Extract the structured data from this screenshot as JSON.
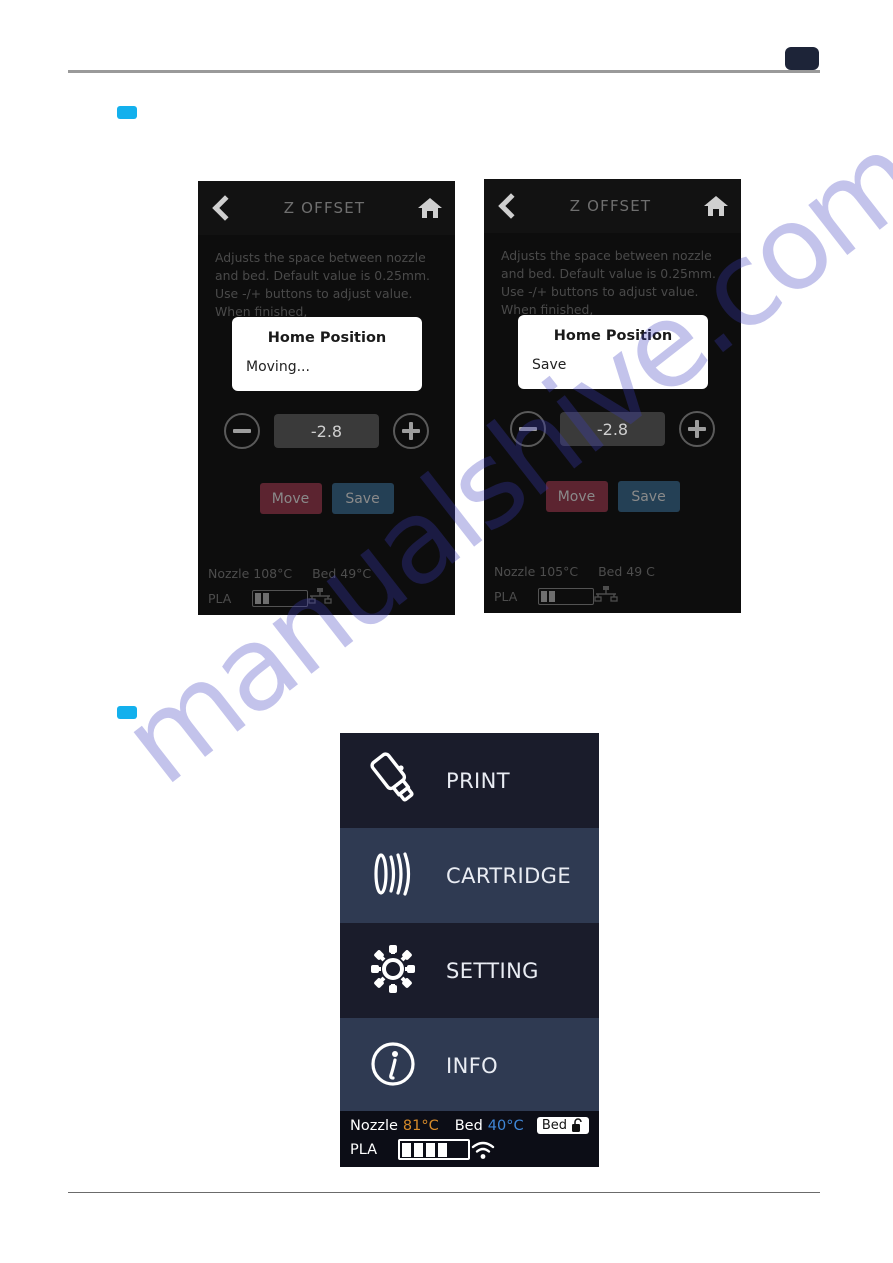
{
  "watermark": {
    "text": "manualshive.com"
  },
  "markers": {
    "first": "section-marker",
    "second": "section-marker"
  },
  "zscreens": [
    {
      "id": "z-offset-moving",
      "title": "Z OFFSET",
      "back_icon": "back-chevron-icon",
      "home_icon": "home-icon",
      "description": "Adjusts the space between nozzle and bed. Default value is 0.25mm. Use -/+ buttons to adjust value. When finished,",
      "dialog": {
        "title": "Home Position",
        "body": "Moving..."
      },
      "minus_label": "−",
      "plus_label": "+",
      "value": "-2.8",
      "move_label": "Move",
      "save_label": "Save",
      "status": {
        "nozzle_label": "Nozzle",
        "nozzle_value": "108°C",
        "bed_label": "Bed",
        "bed_value": "49°C",
        "material": "PLA",
        "network_icon": "ethernet-icon"
      }
    },
    {
      "id": "z-offset-save",
      "title": "Z OFFSET",
      "back_icon": "back-chevron-icon",
      "home_icon": "home-icon",
      "description": "Adjusts the space between nozzle and bed. Default value is 0.25mm. Use -/+ buttons to adjust value. When finished,",
      "dialog": {
        "title": "Home Position",
        "body": "Save"
      },
      "minus_label": "−",
      "plus_label": "+",
      "value": "-2.8",
      "move_label": "Move",
      "save_label": "Save",
      "status": {
        "nozzle_label": "Nozzle",
        "nozzle_value": "105°C",
        "bed_label": "Bed",
        "bed_value": "49 C",
        "material": "PLA",
        "network_icon": "ethernet-icon"
      }
    }
  ],
  "menu": {
    "items": [
      {
        "label": "PRINT",
        "icon": "usb-drive-icon"
      },
      {
        "label": "CARTRIDGE",
        "icon": "cartridge-nfc-icon"
      },
      {
        "label": "SETTING",
        "icon": "gear-icon"
      },
      {
        "label": "INFO",
        "icon": "info-icon"
      }
    ],
    "status": {
      "nozzle_label": "Nozzle",
      "nozzle_value": "81°C",
      "bed_label": "Bed",
      "bed_value": "40°C",
      "material": "PLA",
      "bed_chip_label": "Bed",
      "lock_icon": "unlocked-padlock-icon",
      "wifi_icon": "wifi-icon"
    },
    "colors": {
      "row_dark": "#1a1c2b",
      "row_light": "#2f3a52",
      "nozzle_temp": "#d58a2a",
      "bed_temp": "#3f87d8"
    }
  }
}
